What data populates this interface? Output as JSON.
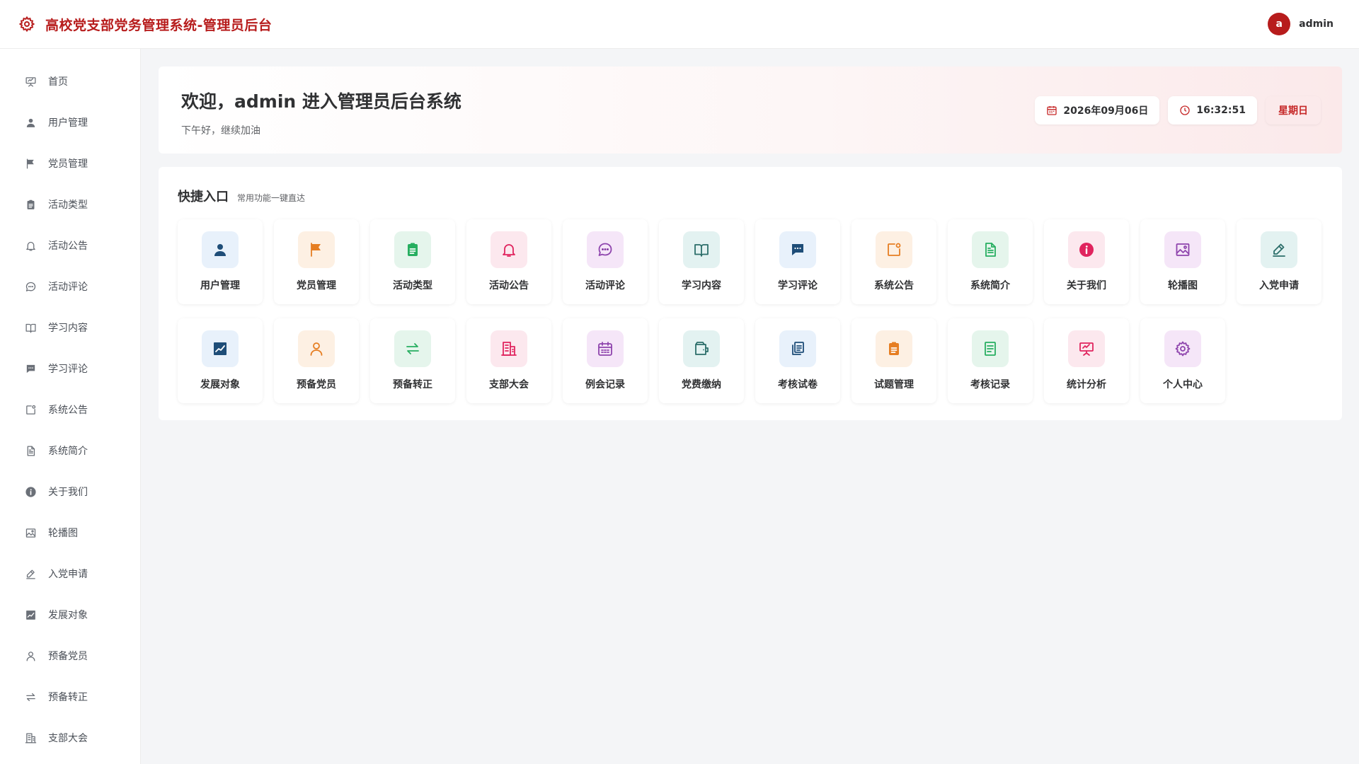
{
  "header": {
    "title": "高校党支部党务管理系统-管理员后台",
    "avatar_letter": "a",
    "username": "admin"
  },
  "sidebar": {
    "items": [
      {
        "label": "首页",
        "icon": "presentation-icon"
      },
      {
        "label": "用户管理",
        "icon": "user-icon"
      },
      {
        "label": "党员管理",
        "icon": "flag-icon"
      },
      {
        "label": "活动类型",
        "icon": "clipboard-icon"
      },
      {
        "label": "活动公告",
        "icon": "bell-icon"
      },
      {
        "label": "活动评论",
        "icon": "chat-icon"
      },
      {
        "label": "学习内容",
        "icon": "book-icon"
      },
      {
        "label": "学习评论",
        "icon": "comment-icon"
      },
      {
        "label": "系统公告",
        "icon": "notice-icon"
      },
      {
        "label": "系统简介",
        "icon": "document-icon"
      },
      {
        "label": "关于我们",
        "icon": "info-icon"
      },
      {
        "label": "轮播图",
        "icon": "image-icon"
      },
      {
        "label": "入党申请",
        "icon": "edit-icon"
      },
      {
        "label": "发展对象",
        "icon": "chart-icon"
      },
      {
        "label": "预备党员",
        "icon": "person-icon"
      },
      {
        "label": "预备转正",
        "icon": "transfer-icon"
      },
      {
        "label": "支部大会",
        "icon": "building-icon"
      }
    ]
  },
  "welcome": {
    "title": "欢迎，admin 进入管理员后台系统",
    "subtitle": "下午好，继续加油",
    "date": "2026年09月06日",
    "time": "16:32:51",
    "weekday": "星期日"
  },
  "quick": {
    "title": "快捷入口",
    "subtitle": "常用功能一键直达",
    "tiles": [
      {
        "label": "用户管理",
        "icon": "user-icon",
        "bg": "#e8f1fb",
        "fg": "#1e4d78"
      },
      {
        "label": "党员管理",
        "icon": "flag-icon",
        "bg": "#fdf0e3",
        "fg": "#e67e22"
      },
      {
        "label": "活动类型",
        "icon": "clipboard-icon",
        "bg": "#e5f5ec",
        "fg": "#27ae60"
      },
      {
        "label": "活动公告",
        "icon": "bell-icon",
        "bg": "#fce8ee",
        "fg": "#e0245e"
      },
      {
        "label": "活动评论",
        "icon": "chat-icon",
        "bg": "#f5e6f8",
        "fg": "#8e44ad"
      },
      {
        "label": "学习内容",
        "icon": "book-icon",
        "bg": "#e3f2f1",
        "fg": "#2c6e6a"
      },
      {
        "label": "学习评论",
        "icon": "comment-icon",
        "bg": "#e8f1fb",
        "fg": "#1e4d78"
      },
      {
        "label": "系统公告",
        "icon": "notice-icon",
        "bg": "#fdf0e3",
        "fg": "#e67e22"
      },
      {
        "label": "系统简介",
        "icon": "document-icon",
        "bg": "#e5f5ec",
        "fg": "#27ae60"
      },
      {
        "label": "关于我们",
        "icon": "info-icon",
        "bg": "#fce8ee",
        "fg": "#e0245e"
      },
      {
        "label": "轮播图",
        "icon": "image-icon",
        "bg": "#f5e6f8",
        "fg": "#8e44ad"
      },
      {
        "label": "入党申请",
        "icon": "edit-icon",
        "bg": "#e3f2f1",
        "fg": "#2c6e6a"
      },
      {
        "label": "发展对象",
        "icon": "chart-icon",
        "bg": "#e8f1fb",
        "fg": "#1e4d78"
      },
      {
        "label": "预备党员",
        "icon": "person-icon",
        "bg": "#fdf0e3",
        "fg": "#e67e22"
      },
      {
        "label": "预备转正",
        "icon": "transfer-icon",
        "bg": "#e5f5ec",
        "fg": "#27ae60"
      },
      {
        "label": "支部大会",
        "icon": "building-icon",
        "bg": "#fce8ee",
        "fg": "#e0245e"
      },
      {
        "label": "例会记录",
        "icon": "calendar-icon",
        "bg": "#f5e6f8",
        "fg": "#8e44ad"
      },
      {
        "label": "党费缴纳",
        "icon": "wallet-icon",
        "bg": "#e3f2f1",
        "fg": "#2c6e6a"
      },
      {
        "label": "考核试卷",
        "icon": "papers-icon",
        "bg": "#e8f1fb",
        "fg": "#1e4d78"
      },
      {
        "label": "试题管理",
        "icon": "clipboard-icon",
        "bg": "#fdf0e3",
        "fg": "#e67e22"
      },
      {
        "label": "考核记录",
        "icon": "record-icon",
        "bg": "#e5f5ec",
        "fg": "#27ae60"
      },
      {
        "label": "统计分析",
        "icon": "presentation-icon",
        "bg": "#fce8ee",
        "fg": "#e0245e"
      },
      {
        "label": "个人中心",
        "icon": "gear-icon",
        "bg": "#f5e6f8",
        "fg": "#8e44ad"
      }
    ]
  },
  "colors": {
    "brand": "#b71c1c",
    "sidebar_icon": "#6b7078"
  }
}
